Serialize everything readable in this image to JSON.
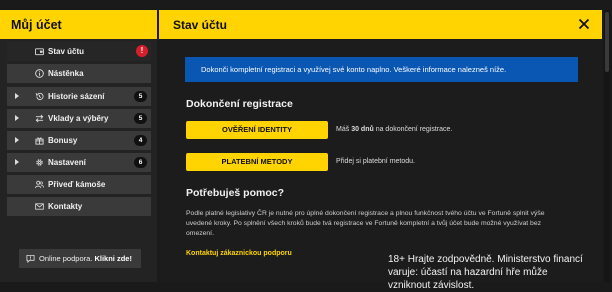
{
  "sidebar": {
    "title": "Můj účet",
    "items": [
      {
        "label": "Stav účtu",
        "alert": "!"
      },
      {
        "label": "Nástěnka"
      },
      {
        "label": "Historie sázení",
        "count": "5"
      },
      {
        "label": "Vklady a výběry",
        "count": "5"
      },
      {
        "label": "Bonusy",
        "count": "4"
      },
      {
        "label": "Nastavení",
        "count": "6"
      },
      {
        "label": "Přiveď kámoše"
      },
      {
        "label": "Kontakty"
      }
    ],
    "support": {
      "text": "Online podpora.",
      "cta": "Klikni zde!"
    }
  },
  "main": {
    "title": "Stav účtu",
    "info": "Dokonči kompletní registraci a využívej své konto naplno. Veškeré informace nalezneš níže.",
    "registration": {
      "title": "Dokončení registrace",
      "verify_button": "OVĚŘENÍ IDENTITY",
      "verify_note_pre": "Máš",
      "verify_note_days": "30 dnů",
      "verify_note_post": "na dokončení registrace.",
      "payment_button": "PLATEBNÍ METODY",
      "payment_note": "Přidej si platební metodu."
    },
    "help": {
      "title": "Potřebuješ pomoc?",
      "text": "Podle platné legislativy ČR je nutné pro úplné dokončení registrace a plnou funkčnost tvého účtu ve Fortuně splnit výše uvedené kroky. Po splnění všech kroků bude tvá registrace ve Fortuně kompletní a tvůj účet bude možné využívat bez omezení.",
      "link": "Kontaktuj zákaznickou podporu"
    },
    "responsible_gaming": "18+ Hrajte zodpovědně. Ministerstvo financí varuje: účastí na hazardní hře může vzniknout závislost."
  },
  "colors": {
    "accent": "#ffd400",
    "info_bg": "#0a57b3",
    "alert": "#d61f2c"
  }
}
